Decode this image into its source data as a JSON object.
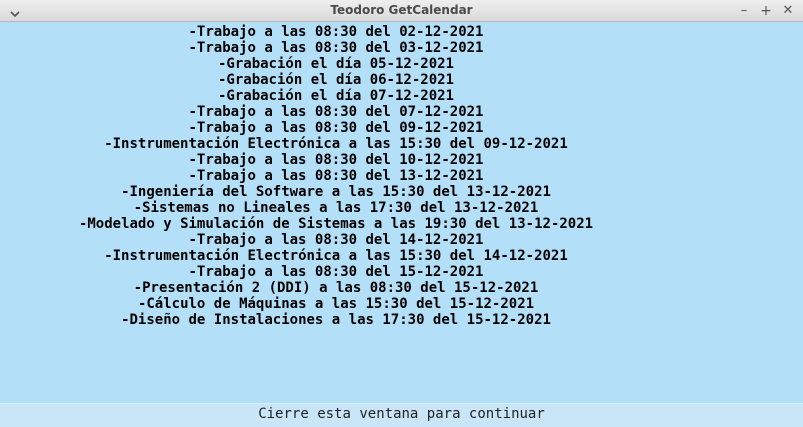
{
  "window": {
    "title": "Teodoro GetCalendar"
  },
  "events": [
    "-Trabajo a las 08:30 del 02-12-2021",
    "-Trabajo a las 08:30 del 03-12-2021",
    "-Grabación el día 05-12-2021",
    "-Grabación el día 06-12-2021",
    "-Grabación el día 07-12-2021",
    "-Trabajo a las 08:30 del 07-12-2021",
    "-Trabajo a las 08:30 del 09-12-2021",
    "-Instrumentación Electrónica a las 15:30 del 09-12-2021",
    "-Trabajo a las 08:30 del 10-12-2021",
    "-Trabajo a las 08:30 del 13-12-2021",
    "-Ingeniería del Software a las 15:30 del 13-12-2021",
    "-Sistemas no Lineales a las 17:30 del 13-12-2021",
    "-Modelado y Simulación de Sistemas a las 19:30 del 13-12-2021",
    "-Trabajo a las 08:30 del 14-12-2021",
    "-Instrumentación Electrónica a las 15:30 del 14-12-2021",
    "-Trabajo a las 08:30 del 15-12-2021",
    "-Presentación 2 (DDI) a las 08:30 del 15-12-2021",
    "-Cálculo de Máquinas a las 15:30 del 15-12-2021",
    "-Diseño de Instalaciones a las 17:30 del 15-12-2021"
  ],
  "footer": {
    "message": "Cierre esta ventana para continuar"
  }
}
